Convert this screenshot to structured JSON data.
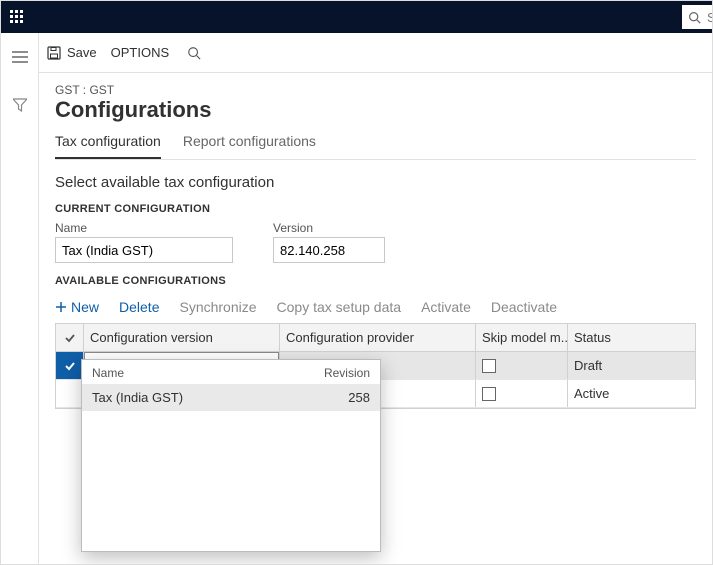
{
  "topbar": {
    "search_placeholder": "Se"
  },
  "actionbar": {
    "save_label": "Save",
    "options_label": "OPTIONS"
  },
  "breadcrumb": "GST : GST",
  "page_title": "Configurations",
  "tabs": {
    "tax": "Tax configuration",
    "report": "Report configurations"
  },
  "section_title": "Select available tax configuration",
  "current": {
    "heading": "CURRENT CONFIGURATION",
    "name_label": "Name",
    "name_value": "Tax (India GST)",
    "version_label": "Version",
    "version_value": "82.140.258"
  },
  "available": {
    "heading": "AVAILABLE CONFIGURATIONS",
    "toolbar": {
      "new": "New",
      "delete": "Delete",
      "synchronize": "Synchronize",
      "copy": "Copy tax setup data",
      "activate": "Activate",
      "deactivate": "Deactivate"
    },
    "columns": {
      "version": "Configuration version",
      "provider": "Configuration provider",
      "skip": "Skip model m...",
      "status": "Status"
    },
    "rows": [
      {
        "version": "",
        "provider": "",
        "skip": false,
        "status": "Draft"
      },
      {
        "version": "",
        "provider": "",
        "skip": false,
        "status": "Active"
      }
    ]
  },
  "dropdown": {
    "col_name": "Name",
    "col_revision": "Revision",
    "items": [
      {
        "name": "Tax (India GST)",
        "revision": "258"
      }
    ]
  }
}
